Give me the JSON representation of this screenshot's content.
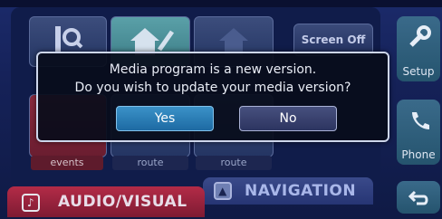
{
  "dialog": {
    "line1": "Media program is a new version.",
    "line2": "Do you wish to update your media version?",
    "yes_label": "Yes",
    "no_label": "No"
  },
  "top_bar": {
    "screen_off_label": "Screen Off"
  },
  "side": {
    "setup_label": "Setup",
    "phone_label": "Phone"
  },
  "bottom_labels": [
    "events",
    "route",
    "route"
  ],
  "tabs": {
    "audio_visual": "AUDIO/VISUAL",
    "navigation": "NAVIGATION"
  },
  "icons": {
    "search": "search-icon",
    "home_edit": "home-edit-icon",
    "home": "home-icon",
    "wrench": "wrench-icon",
    "phone": "phone-icon",
    "back": "back-arrow-icon",
    "music": "music-note-icon",
    "navigation": "navigation-arrow-icon"
  },
  "colors": {
    "yes_button": "#2a7fbf",
    "no_button": "#3b4370",
    "audio_tab": "#a3263f",
    "nav_tab": "#2f3f80",
    "side_buttons": "#2f6080"
  }
}
